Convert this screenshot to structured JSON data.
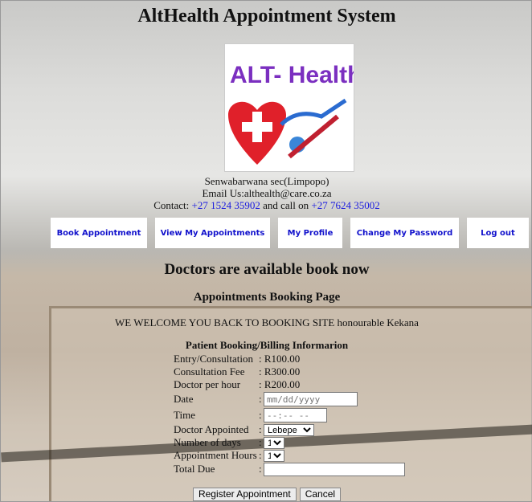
{
  "header": {
    "title": "AltHealth Appointment System",
    "logo_text": "ALT- Health"
  },
  "info": {
    "address": "Senwabarwana sec(Limpopo)",
    "email": "Email Us:althealth@care.co.za",
    "contact_prefix": "Contact: ",
    "phone1": "+27 1524 35902",
    "contact_mid": " and call on ",
    "phone2": "+27 7624 35002"
  },
  "nav": [
    {
      "label": "Book Appointment"
    },
    {
      "label": "View My Appointments"
    },
    {
      "label": "My Profile"
    },
    {
      "label": "Change My Password"
    },
    {
      "label": "Log out"
    }
  ],
  "main": {
    "heading": "Doctors are available book now",
    "subheading": "Appointments Booking Page",
    "welcome": "WE WELCOME YOU BACK TO BOOKING SITE honourable Kekana",
    "form_title": "Patient Booking/Billing Informarion"
  },
  "form": {
    "entry_label": "Entry/Consultation",
    "entry_value": ": R100.00",
    "fee_label": "Consultation Fee",
    "fee_value": ": R300.00",
    "doctor_rate_label": "Doctor per hour",
    "doctor_rate_value": ": R200.00",
    "date_label": "Date",
    "date_placeholder": "mm/dd/yyyy",
    "time_label": "Time",
    "time_placeholder": "--:-- --",
    "doctor_label": "Doctor Appointed",
    "doctor_value": "Lebepe",
    "days_label": "Number of days",
    "days_value": "1",
    "hours_label": "Appointment Hours",
    "hours_value": "1",
    "total_label": "Total Due",
    "total_value": "",
    "colon": ":",
    "register_label": "Register Appointment",
    "cancel_label": "Cancel"
  }
}
